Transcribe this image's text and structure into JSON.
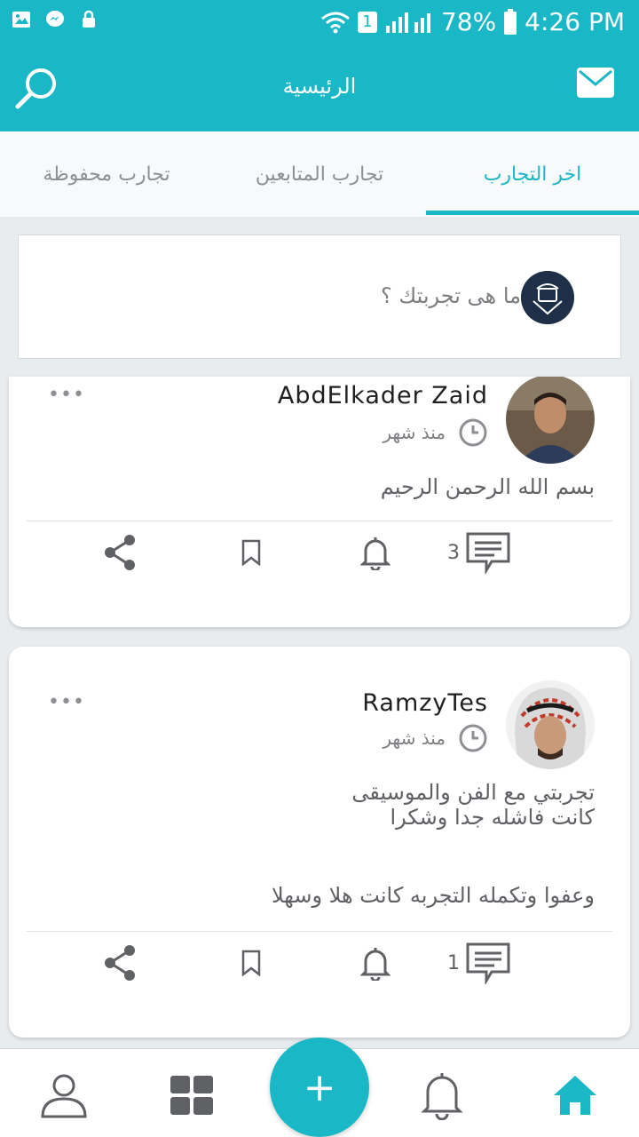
{
  "status_bar": {
    "battery": "78%",
    "time": "4:26 PM",
    "sim_badge": "1"
  },
  "app_bar": {
    "title": "الرئيسية"
  },
  "tabs": [
    {
      "label": "اخر التجارب",
      "active": true
    },
    {
      "label": "تجارب المتابعين",
      "active": false
    },
    {
      "label": "تجارب محفوظة",
      "active": false
    }
  ],
  "composer": {
    "prompt": "ما هى تجربتك ؟"
  },
  "posts": [
    {
      "username": "AbdElkader Zaid",
      "time": "منذ شهر",
      "more": "•••",
      "lines": [
        "بسم الله الرحمن الرحيم"
      ],
      "comment_count": "3"
    },
    {
      "username": "RamzyTes",
      "time": "منذ شهر",
      "more": "•••",
      "lines": [
        "تجربتي مع الفن والموسيقى",
        "كانت فاشله جدا وشكرا",
        "وعفوا وتكمله التجربه كانت هلا وسهلا"
      ],
      "comment_count": "1"
    }
  ],
  "fab": {
    "label": "+"
  },
  "colors": {
    "accent": "#1ab7c6",
    "icon_gray": "#5f6165",
    "text_gray": "#7b7d80"
  },
  "icons": {
    "status_left": [
      "gallery-icon",
      "messenger-icon",
      "lock-icon"
    ],
    "status_right": [
      "wifi-icon",
      "signal-icon",
      "battery-icon"
    ],
    "app_bar": [
      "search-icon",
      "mail-icon"
    ],
    "post_actions": [
      "share-icon",
      "bookmark-icon",
      "bell-icon",
      "comment-icon"
    ],
    "bottom_nav": [
      "profile-icon",
      "grid-icon",
      "bell-icon",
      "home-icon"
    ]
  }
}
